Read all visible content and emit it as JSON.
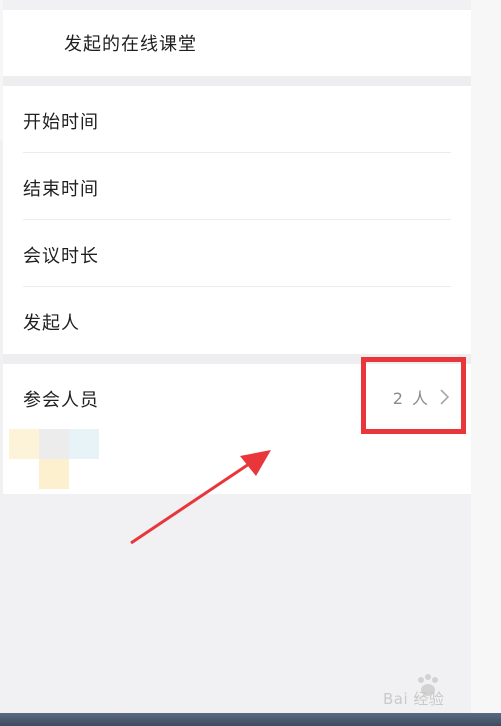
{
  "title_card": {
    "title": "发起的在线课堂"
  },
  "info_rows": [
    {
      "label": "开始时间"
    },
    {
      "label": "结束时间"
    },
    {
      "label": "会议时长"
    },
    {
      "label": "发起人"
    }
  ],
  "attendees": {
    "label": "参会人员",
    "count": "2 人"
  },
  "watermark": {
    "text": "Bai 经验"
  },
  "colors": {
    "highlight": "#e8363b",
    "background": "#f1f1f3"
  }
}
